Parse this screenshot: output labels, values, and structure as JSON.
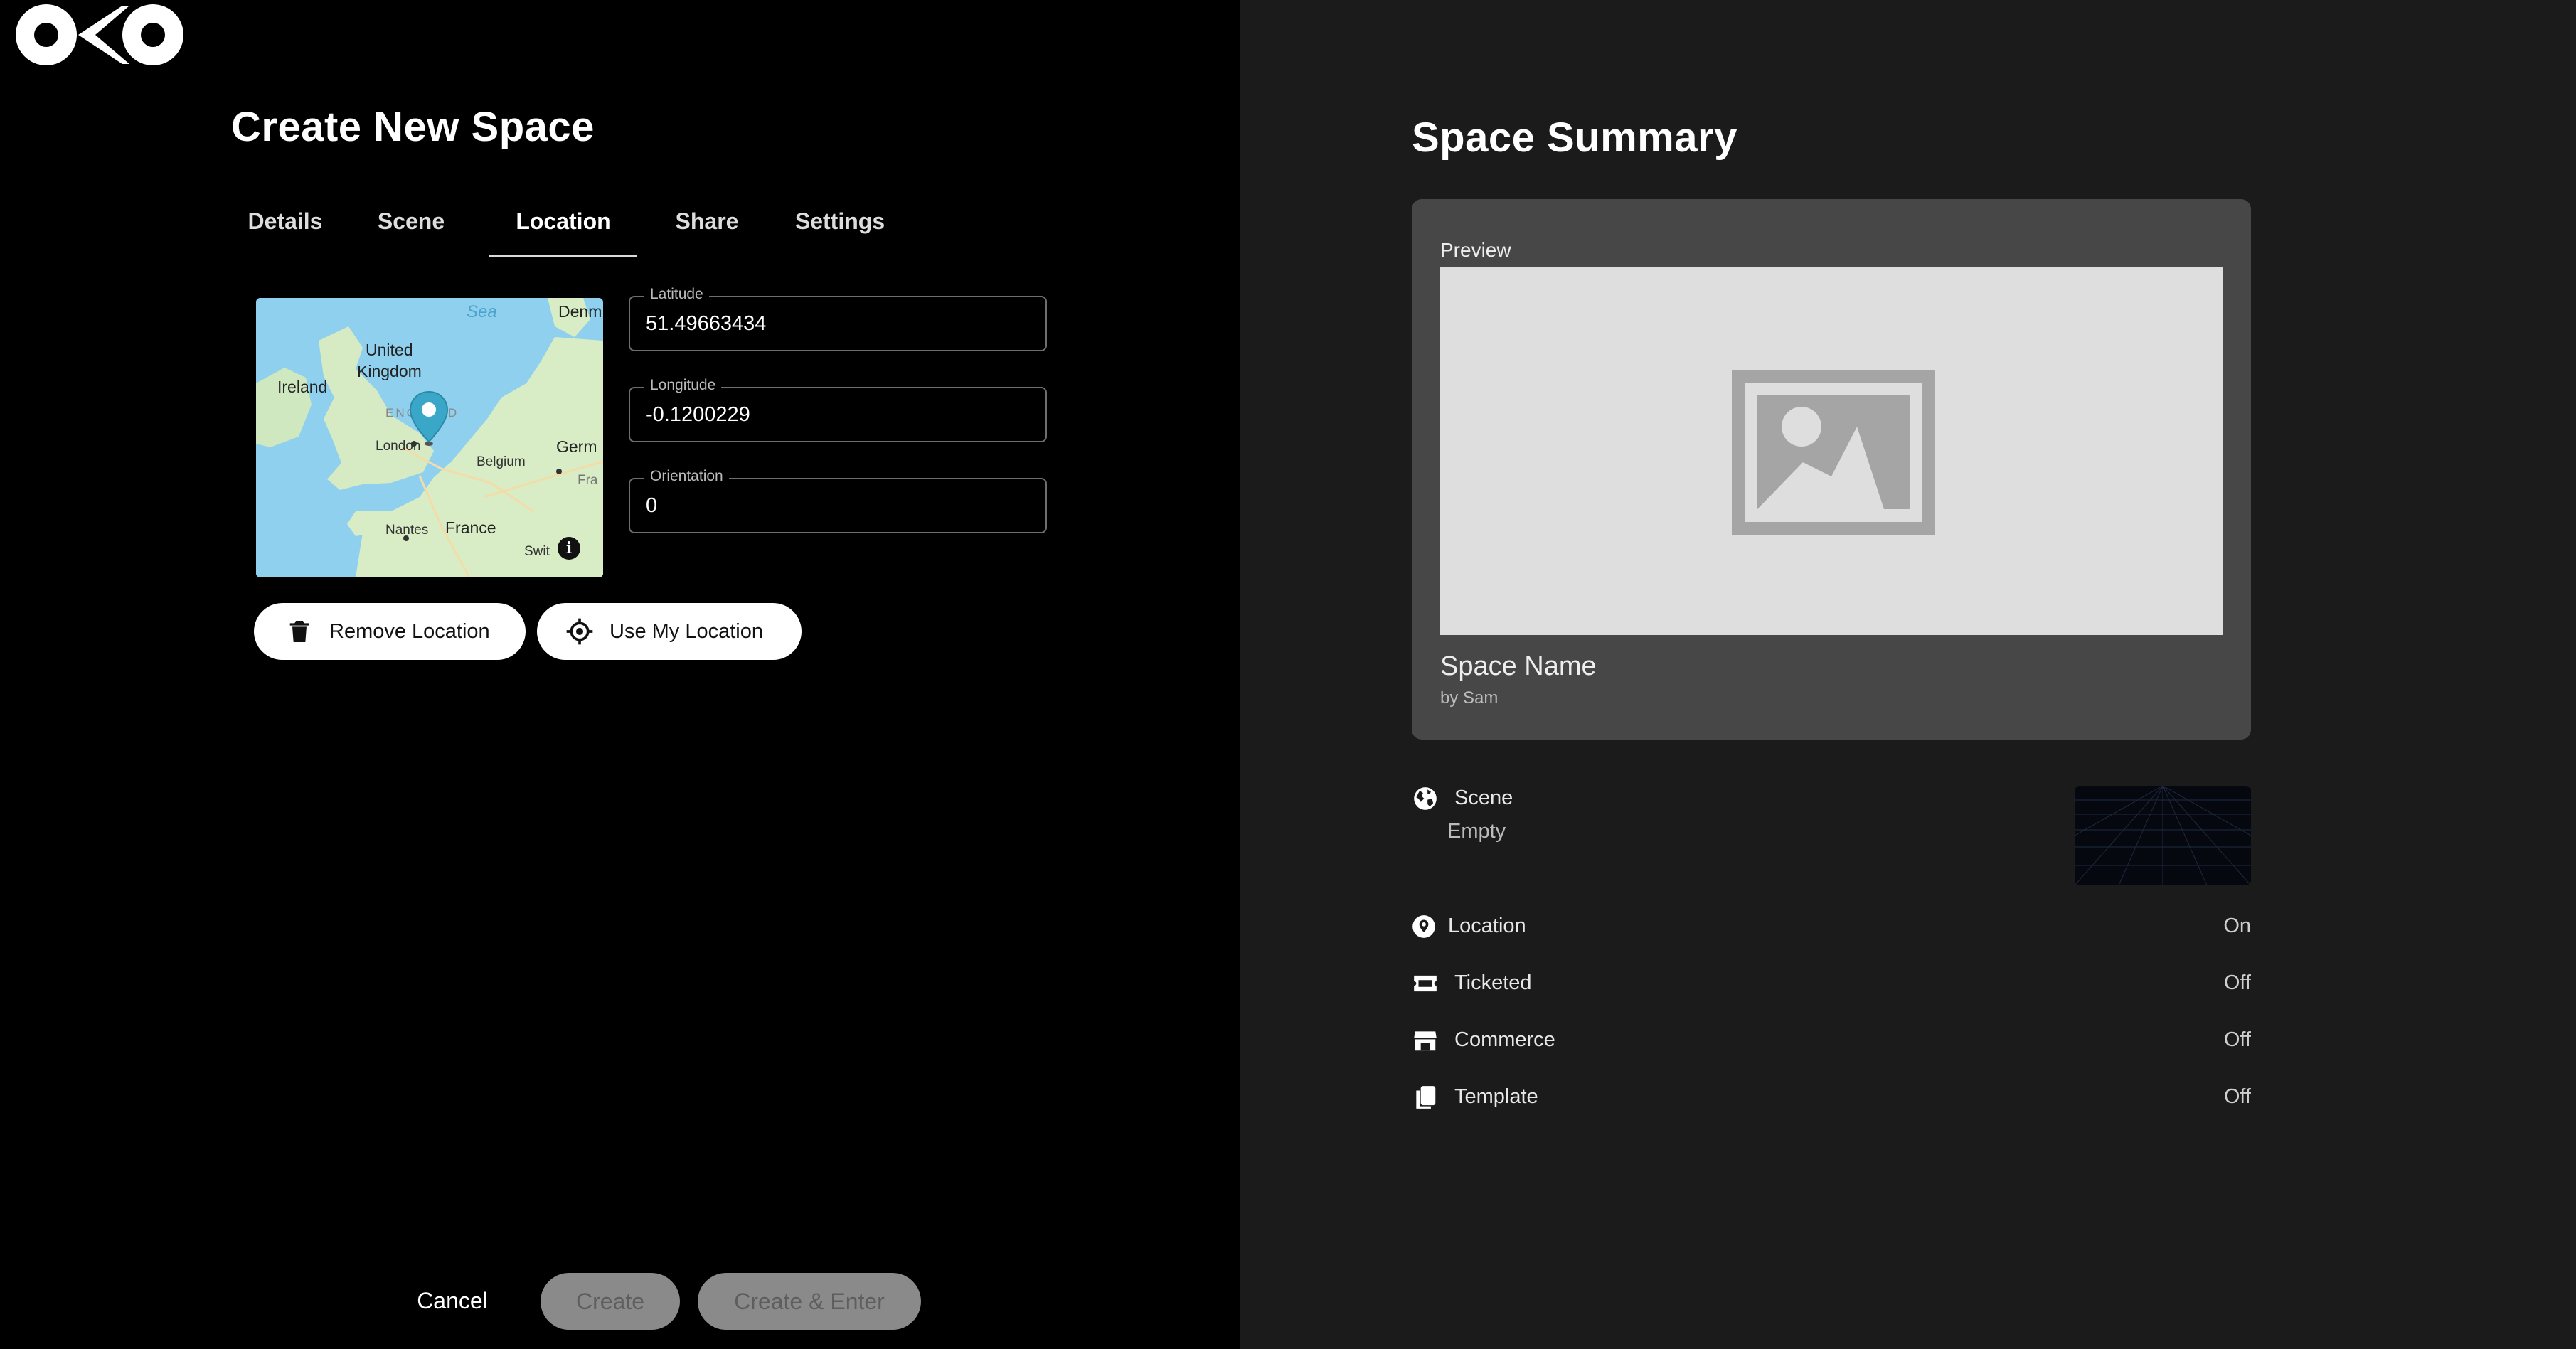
{
  "brand": {
    "logo_text": "OKO"
  },
  "header": {
    "title": "Create New Space"
  },
  "tabs": [
    {
      "label": "Details",
      "active": false
    },
    {
      "label": "Scene",
      "active": false
    },
    {
      "label": "Location",
      "active": true
    },
    {
      "label": "Share",
      "active": false
    },
    {
      "label": "Settings",
      "active": false
    }
  ],
  "map": {
    "labels": {
      "sea": "Sea",
      "denmark": "Denm",
      "uk": "United Kingdom",
      "uk_line1": "United",
      "uk_line2": "Kingdom",
      "ireland": "Ireland",
      "england": "ENGLAND",
      "london": "London",
      "belgium": "Belgium",
      "germany": "Germ",
      "france_small": "Fra",
      "france": "France",
      "nantes": "Nantes",
      "switzerland": "Swit"
    },
    "info_glyph": "i"
  },
  "fields": {
    "latitude": {
      "label": "Latitude",
      "value": "51.49663434"
    },
    "longitude": {
      "label": "Longitude",
      "value": "-0.1200229"
    },
    "orientation": {
      "label": "Orientation",
      "value": "0"
    }
  },
  "actions": {
    "remove_location": "Remove Location",
    "use_my_location": "Use My Location"
  },
  "footer": {
    "cancel": "Cancel",
    "create": "Create",
    "create_enter": "Create & Enter"
  },
  "summary": {
    "title": "Space Summary",
    "preview_label": "Preview",
    "space_name": "Space Name",
    "author": "by Sam",
    "rows": {
      "scene": {
        "label": "Scene",
        "value": "Empty",
        "icon": "globe-icon"
      },
      "location": {
        "label": "Location",
        "value": "On",
        "icon": "location-pin-icon"
      },
      "ticketed": {
        "label": "Ticketed",
        "value": "Off",
        "icon": "ticket-icon"
      },
      "commerce": {
        "label": "Commerce",
        "value": "Off",
        "icon": "storefront-icon"
      },
      "template": {
        "label": "Template",
        "value": "Off",
        "icon": "copy-icon"
      }
    }
  },
  "colors": {
    "left_bg": "#000000",
    "right_bg": "#1b1b1b",
    "card_bg": "#474747",
    "map_pin": "#3aa7c9",
    "disabled_button": "#8a8a8a"
  }
}
